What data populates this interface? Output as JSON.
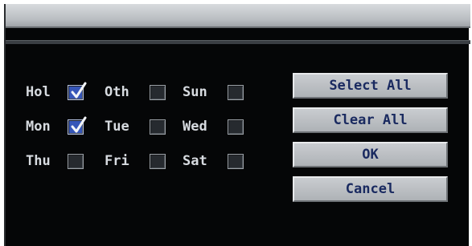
{
  "days": [
    {
      "key": "hol",
      "label": "Hol",
      "checked": true
    },
    {
      "key": "oth",
      "label": "Oth",
      "checked": false
    },
    {
      "key": "sun",
      "label": "Sun",
      "checked": false
    },
    {
      "key": "mon",
      "label": "Mon",
      "checked": true
    },
    {
      "key": "tue",
      "label": "Tue",
      "checked": false
    },
    {
      "key": "wed",
      "label": "Wed",
      "checked": false
    },
    {
      "key": "thu",
      "label": "Thu",
      "checked": false
    },
    {
      "key": "fri",
      "label": "Fri",
      "checked": false
    },
    {
      "key": "sat",
      "label": "Sat",
      "checked": false
    }
  ],
  "buttons": {
    "select_all": "Select All",
    "clear_all": "Clear All",
    "ok": "OK",
    "cancel": "Cancel"
  },
  "colors": {
    "background": "#050607",
    "title_bar": "#c4c7ca",
    "label_text": "#d7dbe0",
    "button_text": "#1a2a60",
    "checked_fill": "#3656b8"
  }
}
